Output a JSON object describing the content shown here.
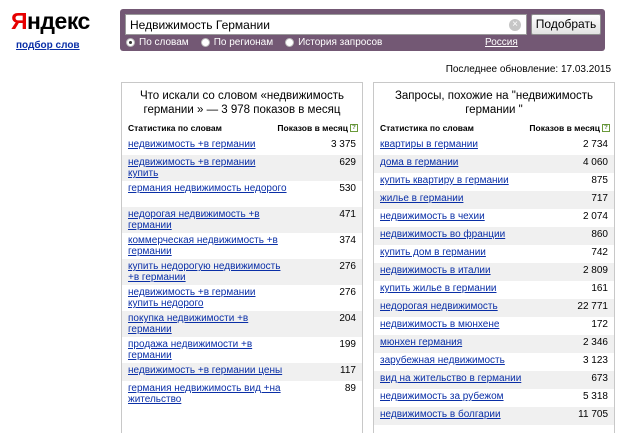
{
  "header": {
    "logo_first": "Я",
    "logo_rest": "ндекс",
    "wordstat_link": "подбор слов"
  },
  "search": {
    "query": "Недвижимость Германии",
    "button_label": "Подобрать",
    "clear_glyph": "×",
    "modes": [
      {
        "label": "По словам",
        "checked": true
      },
      {
        "label": "По регионам",
        "checked": false
      },
      {
        "label": "История запросов",
        "checked": false
      }
    ],
    "region": "Россия"
  },
  "last_update": "Последнее обновление: 17.03.2015",
  "left_panel": {
    "title": "Что искали со словом «недвижимость германии » — 3 978 показов в месяц",
    "col_phrase": "Статистика по словам",
    "col_count": "Показов в месяц",
    "rows": [
      {
        "phrase": "недвижимость +в германии",
        "count": "3 375",
        "single": true
      },
      {
        "phrase": "недвижимость +в германии купить",
        "count": "629",
        "single": false
      },
      {
        "phrase": "германия недвижимость недорого",
        "count": "530",
        "single": false
      },
      {
        "phrase": "недорогая недвижимость +в германии",
        "count": "471",
        "single": false
      },
      {
        "phrase": "коммерческая недвижимость +в германии",
        "count": "374",
        "single": false
      },
      {
        "phrase": "купить недорогую недвижимость +в германии",
        "count": "276",
        "single": false
      },
      {
        "phrase": "недвижимость +в германии купить недорого",
        "count": "276",
        "single": false
      },
      {
        "phrase": "покупка недвижимости +в германии",
        "count": "204",
        "single": false
      },
      {
        "phrase": "продажа недвижимости +в германии",
        "count": "199",
        "single": false
      },
      {
        "phrase": "недвижимость +в германии цены",
        "count": "117",
        "single": true
      },
      {
        "phrase": "германия недвижимость вид +на жительство",
        "count": "89",
        "single": false
      }
    ]
  },
  "right_panel": {
    "title": "Запросы, похожие на \"недвижимость германии \"",
    "col_phrase": "Статистика по словам",
    "col_count": "Показов в месяц",
    "rows": [
      {
        "phrase": "квартиры в германии",
        "count": "2 734"
      },
      {
        "phrase": "дома в германии",
        "count": "4 060"
      },
      {
        "phrase": "купить квартиру в германии",
        "count": "875"
      },
      {
        "phrase": "жилье в германии",
        "count": "717"
      },
      {
        "phrase": "недвижимость в чехии",
        "count": "2 074"
      },
      {
        "phrase": "недвижимость во франции",
        "count": "860"
      },
      {
        "phrase": "купить дом в германии",
        "count": "742"
      },
      {
        "phrase": "недвижимость в италии",
        "count": "2 809"
      },
      {
        "phrase": "купить жилье в германии",
        "count": "161"
      },
      {
        "phrase": "недорогая недвижимость",
        "count": "22 771"
      },
      {
        "phrase": "недвижимость в мюнхене",
        "count": "172"
      },
      {
        "phrase": "мюнхен германия",
        "count": "2 346"
      },
      {
        "phrase": "зарубежная недвижимость",
        "count": "3 123"
      },
      {
        "phrase": "вид на жительство в германии",
        "count": "673"
      },
      {
        "phrase": "недвижимость за рубежом",
        "count": "5 318"
      },
      {
        "phrase": "недвижимость в болгарии",
        "count": "11 705"
      }
    ]
  }
}
